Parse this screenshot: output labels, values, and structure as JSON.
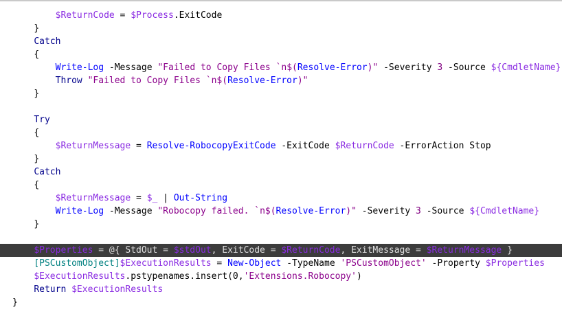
{
  "editor": {
    "theme": {
      "background": "#ffffff",
      "highlight_line": "#3c3c3c"
    },
    "lines": [
      {
        "indent": 8,
        "highlighted": false,
        "tokens": [
          {
            "t": "$ReturnCode",
            "c": "#8a2be2"
          },
          {
            "t": " = ",
            "c": "#000000"
          },
          {
            "t": "$Process",
            "c": "#8a2be2"
          },
          {
            "t": ".",
            "c": "#000000"
          },
          {
            "t": "ExitCode",
            "c": "#000000"
          }
        ]
      },
      {
        "indent": 4,
        "highlighted": false,
        "tokens": [
          {
            "t": "}",
            "c": "#000000"
          }
        ]
      },
      {
        "indent": 4,
        "highlighted": false,
        "tokens": [
          {
            "t": "Catch",
            "c": "#00008b"
          }
        ]
      },
      {
        "indent": 4,
        "highlighted": false,
        "tokens": [
          {
            "t": "{",
            "c": "#000000"
          }
        ]
      },
      {
        "indent": 8,
        "highlighted": false,
        "tokens": [
          {
            "t": "Write-Log",
            "c": "#0000ff"
          },
          {
            "t": " -Message ",
            "c": "#000000"
          },
          {
            "t": "\"Failed to Copy Files `n$(",
            "c": "#8b008b"
          },
          {
            "t": "Resolve-Error",
            "c": "#0000ff"
          },
          {
            "t": ")\"",
            "c": "#8b008b"
          },
          {
            "t": " -Severity ",
            "c": "#000000"
          },
          {
            "t": "3",
            "c": "#800080"
          },
          {
            "t": " -Source ",
            "c": "#000000"
          },
          {
            "t": "${CmdletName}",
            "c": "#8a2be2"
          }
        ]
      },
      {
        "indent": 8,
        "highlighted": false,
        "tokens": [
          {
            "t": "Throw",
            "c": "#00008b"
          },
          {
            "t": " ",
            "c": "#000000"
          },
          {
            "t": "\"Failed to Copy Files `n$(",
            "c": "#8b008b"
          },
          {
            "t": "Resolve-Error",
            "c": "#0000ff"
          },
          {
            "t": ")\"",
            "c": "#8b008b"
          }
        ]
      },
      {
        "indent": 4,
        "highlighted": false,
        "tokens": [
          {
            "t": "}",
            "c": "#000000"
          }
        ]
      },
      {
        "indent": 0,
        "highlighted": false,
        "tokens": []
      },
      {
        "indent": 4,
        "highlighted": false,
        "tokens": [
          {
            "t": "Try",
            "c": "#00008b"
          }
        ]
      },
      {
        "indent": 4,
        "highlighted": false,
        "tokens": [
          {
            "t": "{",
            "c": "#000000"
          }
        ]
      },
      {
        "indent": 8,
        "highlighted": false,
        "tokens": [
          {
            "t": "$ReturnMessage",
            "c": "#8a2be2"
          },
          {
            "t": " = ",
            "c": "#000000"
          },
          {
            "t": "Resolve-RobocopyExitCode",
            "c": "#0000ff"
          },
          {
            "t": " -ExitCode ",
            "c": "#000000"
          },
          {
            "t": "$ReturnCode",
            "c": "#8a2be2"
          },
          {
            "t": " -ErrorAction Stop",
            "c": "#000000"
          }
        ]
      },
      {
        "indent": 4,
        "highlighted": false,
        "tokens": [
          {
            "t": "}",
            "c": "#000000"
          }
        ]
      },
      {
        "indent": 4,
        "highlighted": false,
        "tokens": [
          {
            "t": "Catch",
            "c": "#00008b"
          }
        ]
      },
      {
        "indent": 4,
        "highlighted": false,
        "tokens": [
          {
            "t": "{",
            "c": "#000000"
          }
        ]
      },
      {
        "indent": 8,
        "highlighted": false,
        "tokens": [
          {
            "t": "$ReturnMessage",
            "c": "#8a2be2"
          },
          {
            "t": " = ",
            "c": "#000000"
          },
          {
            "t": "$_",
            "c": "#8a2be2"
          },
          {
            "t": " | ",
            "c": "#000000"
          },
          {
            "t": "Out-String",
            "c": "#0000ff"
          }
        ]
      },
      {
        "indent": 8,
        "highlighted": false,
        "tokens": [
          {
            "t": "Write-Log",
            "c": "#0000ff"
          },
          {
            "t": " -Message ",
            "c": "#000000"
          },
          {
            "t": "\"Robocopy failed. `n$(",
            "c": "#8b008b"
          },
          {
            "t": "Resolve-Error",
            "c": "#0000ff"
          },
          {
            "t": ")\"",
            "c": "#8b008b"
          },
          {
            "t": " -Severity ",
            "c": "#000000"
          },
          {
            "t": "3",
            "c": "#800080"
          },
          {
            "t": " -Source ",
            "c": "#000000"
          },
          {
            "t": "${CmdletName}",
            "c": "#8a2be2"
          }
        ]
      },
      {
        "indent": 4,
        "highlighted": false,
        "tokens": [
          {
            "t": "}",
            "c": "#000000"
          }
        ]
      },
      {
        "indent": 0,
        "highlighted": false,
        "tokens": []
      },
      {
        "indent": 4,
        "highlighted": true,
        "tokens": [
          {
            "t": "$Properties",
            "c": "#8a2be2"
          },
          {
            "t": " = ",
            "c": "#e0e0e0"
          },
          {
            "t": "@{ StdOut = ",
            "c": "#e0e0e0"
          },
          {
            "t": "$stdOut",
            "c": "#8a2be2"
          },
          {
            "t": ", ExitCode = ",
            "c": "#e0e0e0"
          },
          {
            "t": "$ReturnCode",
            "c": "#8a2be2"
          },
          {
            "t": ", ExitMessage = ",
            "c": "#e0e0e0"
          },
          {
            "t": "$ReturnMessage",
            "c": "#8a2be2"
          },
          {
            "t": " }",
            "c": "#e0e0e0"
          }
        ]
      },
      {
        "indent": 4,
        "highlighted": false,
        "tokens": [
          {
            "t": "[PSCustomObject]",
            "c": "#008080"
          },
          {
            "t": "$ExecutionResults",
            "c": "#8a2be2"
          },
          {
            "t": " = ",
            "c": "#000000"
          },
          {
            "t": "New-Object",
            "c": "#0000ff"
          },
          {
            "t": " -TypeName ",
            "c": "#000000"
          },
          {
            "t": "'PSCustomObject'",
            "c": "#8b008b"
          },
          {
            "t": " -Property ",
            "c": "#000000"
          },
          {
            "t": "$Properties",
            "c": "#8a2be2"
          }
        ]
      },
      {
        "indent": 4,
        "highlighted": false,
        "tokens": [
          {
            "t": "$ExecutionResults",
            "c": "#8a2be2"
          },
          {
            "t": ".pstypenames.insert(0,",
            "c": "#000000"
          },
          {
            "t": "'Extensions.Robocopy'",
            "c": "#8b008b"
          },
          {
            "t": ")",
            "c": "#000000"
          }
        ]
      },
      {
        "indent": 4,
        "highlighted": false,
        "tokens": [
          {
            "t": "Return",
            "c": "#00008b"
          },
          {
            "t": " ",
            "c": "#000000"
          },
          {
            "t": "$ExecutionResults",
            "c": "#8a2be2"
          }
        ]
      },
      {
        "indent": 0,
        "highlighted": false,
        "tokens": [
          {
            "t": "}",
            "c": "#000000"
          }
        ]
      }
    ]
  }
}
